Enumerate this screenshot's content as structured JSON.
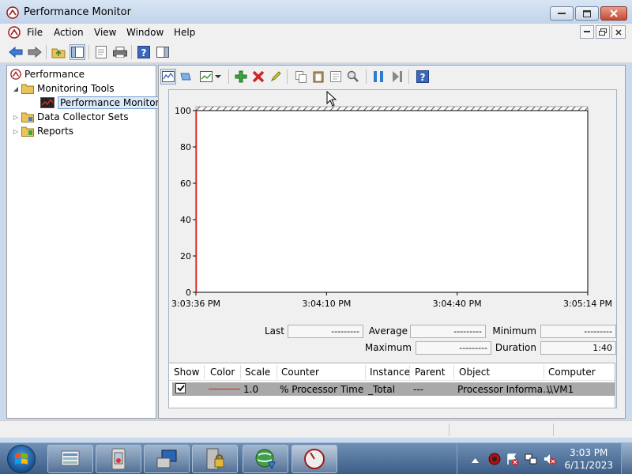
{
  "window": {
    "title": "Performance Monitor"
  },
  "menu": [
    "File",
    "Action",
    "View",
    "Window",
    "Help"
  ],
  "tree": {
    "root": "Performance",
    "items": [
      "Monitoring Tools",
      "Performance Monitor",
      "Data Collector Sets",
      "Reports"
    ]
  },
  "chart_data": {
    "type": "line",
    "title": "",
    "ylim": [
      0,
      100
    ],
    "y_ticks": [
      "100",
      "80",
      "60",
      "40",
      "20",
      "0"
    ],
    "x_ticks": [
      "3:03:36 PM",
      "3:04:10 PM",
      "3:04:40 PM",
      "3:05:14 PM"
    ],
    "grid": false,
    "series": [
      {
        "name": "% Processor Time",
        "color": "#e0201b",
        "values": [
          0
        ]
      }
    ]
  },
  "stats": {
    "last_label": "Last",
    "last": "---------",
    "average_label": "Average",
    "average": "---------",
    "minimum_label": "Minimum",
    "minimum": "---------",
    "maximum_label": "Maximum",
    "maximum": "---------",
    "duration_label": "Duration",
    "duration": "1:40"
  },
  "table": {
    "headers": [
      "Show",
      "Color",
      "Scale",
      "Counter",
      "Instance",
      "Parent",
      "Object",
      "Computer"
    ],
    "row": {
      "scale": "1.0",
      "counter": "% Processor Time",
      "instance": "_Total",
      "parent": "---",
      "object": "Processor Informa...",
      "computer": "\\\\VM1",
      "color": "#e0201b"
    }
  },
  "clock": {
    "time": "3:03 PM",
    "date": "6/11/2023"
  },
  "colors": {
    "accent": "#3c5d86",
    "selection": "#dce9f7"
  }
}
